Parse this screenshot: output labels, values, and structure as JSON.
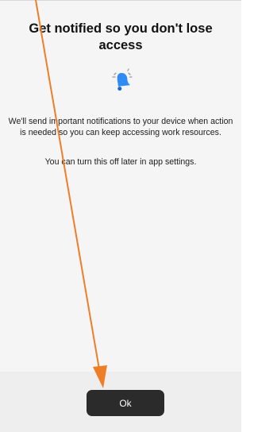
{
  "prompt": {
    "title": "Get notified so you don't lose access",
    "body": "We'll send important notifications to your device when action is needed so you can keep accessing work resources.",
    "note": "You can turn this off later in app settings.",
    "icon": "bell-icon",
    "ok_label": "Ok"
  },
  "colors": {
    "background": "#f5f5f5",
    "button": "#2b2b2b",
    "button_text": "#ffffff",
    "bell": "#2e8cf3",
    "annotation_arrow": "#ef7d28"
  },
  "annotation": {
    "type": "arrow",
    "target": "ok-button"
  }
}
